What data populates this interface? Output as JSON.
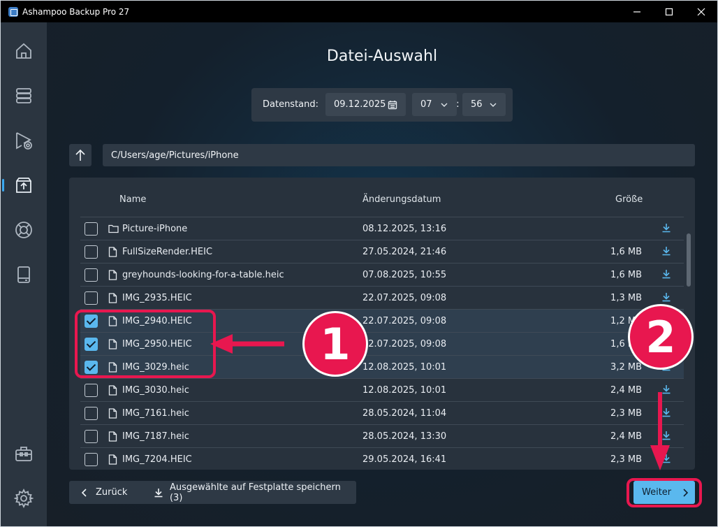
{
  "app": {
    "title": "Ashampoo Backup Pro 27"
  },
  "window_controls": {
    "minimize": "minimize-icon",
    "maximize": "maximize-icon",
    "close": "close-icon"
  },
  "sidebar": {
    "items": [
      {
        "icon": "home-icon",
        "active": false
      },
      {
        "icon": "database-icon",
        "active": false
      },
      {
        "icon": "play-backup-icon",
        "active": false
      },
      {
        "icon": "restore-box-icon",
        "active": true
      },
      {
        "icon": "lifebuoy-icon",
        "active": false
      },
      {
        "icon": "drive-icon",
        "active": false
      },
      {
        "icon": "toolbox-icon",
        "active": false
      },
      {
        "icon": "gear-icon",
        "active": false
      }
    ]
  },
  "page": {
    "title": "Datei-Auswahl"
  },
  "snapshot": {
    "label": "Datenstand:",
    "date": "09.12.2025",
    "hour": "07",
    "separator": ":",
    "minute": "56"
  },
  "path": {
    "value": "C/Users/age/Pictures/iPhone"
  },
  "table": {
    "columns": {
      "name": "Name",
      "date": "Änderungsdatum",
      "size": "Größe"
    },
    "rows": [
      {
        "type": "folder",
        "name": "Picture-iPhone",
        "date": "08.12.2025, 13:16",
        "size": "",
        "checked": false
      },
      {
        "type": "file",
        "name": "FullSizeRender.HEIC",
        "date": "27.05.2024, 21:46",
        "size": "1,6 MB",
        "checked": false
      },
      {
        "type": "file",
        "name": "greyhounds-looking-for-a-table.heic",
        "date": "07.08.2025, 10:55",
        "size": "1,6 MB",
        "checked": false
      },
      {
        "type": "file",
        "name": "IMG_2935.HEIC",
        "date": "22.07.2025, 09:08",
        "size": "1,3 MB",
        "checked": false
      },
      {
        "type": "file",
        "name": "IMG_2940.HEIC",
        "date": "22.07.2025, 09:08",
        "size": "1,2 MB",
        "checked": true
      },
      {
        "type": "file",
        "name": "IMG_2950.HEIC",
        "date": "22.07.2025, 09:08",
        "size": "1,6 MB",
        "checked": true
      },
      {
        "type": "file",
        "name": "IMG_3029.heic",
        "date": "12.08.2025, 10:01",
        "size": "3,2 MB",
        "checked": true
      },
      {
        "type": "file",
        "name": "IMG_3030.heic",
        "date": "12.08.2025, 10:01",
        "size": "2,4 MB",
        "checked": false
      },
      {
        "type": "file",
        "name": "IMG_7161.heic",
        "date": "28.05.2024, 11:04",
        "size": "2,3 MB",
        "checked": false
      },
      {
        "type": "file",
        "name": "IMG_7187.heic",
        "date": "28.05.2024, 13:30",
        "size": "2,4 MB",
        "checked": false
      },
      {
        "type": "file",
        "name": "IMG_7204.HEIC",
        "date": "29.05.2024, 16:41",
        "size": "2,3 MB",
        "checked": false
      }
    ]
  },
  "footer": {
    "back_label": "Zurück",
    "save_label": "Ausgewählte auf Festplatte speichern (3)",
    "next_label": "Weiter"
  },
  "annotations": {
    "badge_1": "1",
    "badge_2": "2",
    "color": "#e8174f"
  }
}
